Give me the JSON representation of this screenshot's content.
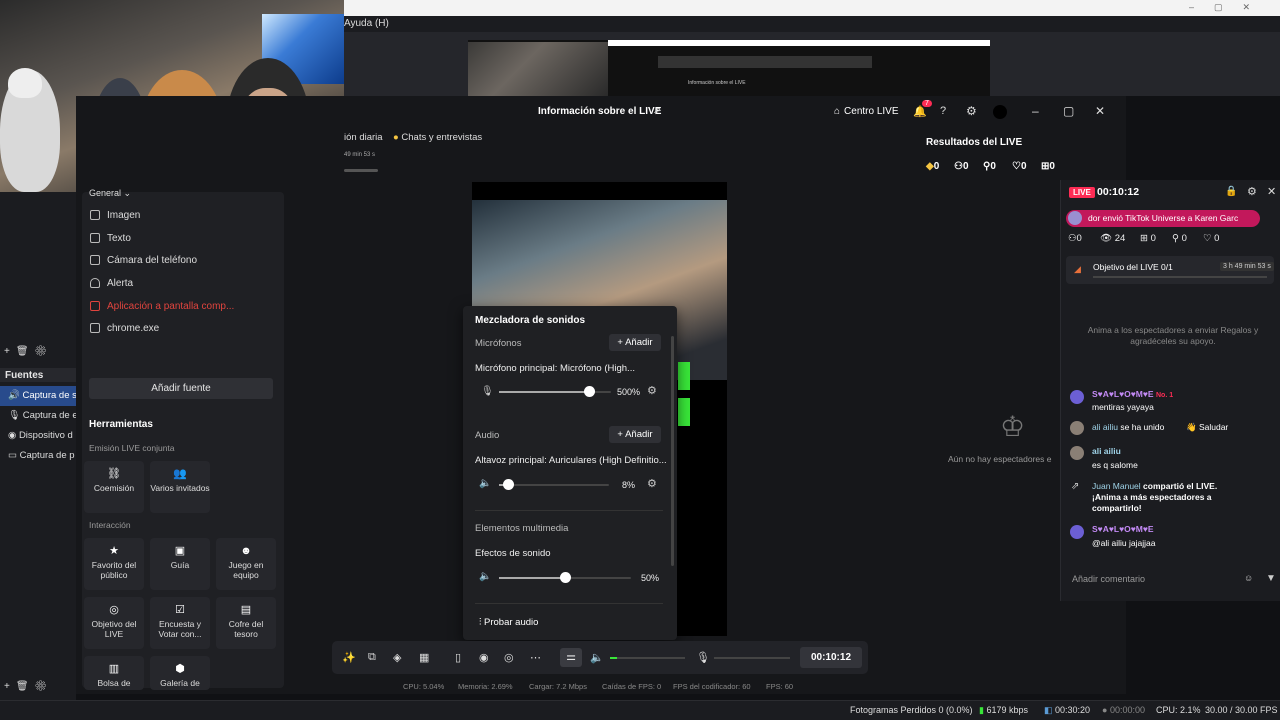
{
  "obs": {
    "menu_help": "Ayuda (H)",
    "sources_header": "Fuentes",
    "sources": [
      "Captura de s",
      "Captura de e",
      "Dispositivo d",
      "Captura de p"
    ],
    "status": {
      "dropped": "Fotogramas Perdidos 0 (0.0%)",
      "bitrate": "6179 kbps",
      "stream_time": "00:30:20",
      "rec_time": "00:00:00",
      "cpu": "CPU: 2.1%",
      "fps": "30.00 / 30.00 FPS"
    }
  },
  "nested_preview": {
    "text": "Información sobre el LIVE"
  },
  "tiktok": {
    "title": "Información sobre el LIVE",
    "centro": "Centro LIVE",
    "notif_count": "7",
    "tabs": [
      "ión diaria",
      "Chats y entrevistas"
    ],
    "tab_small": "49 min 53 s",
    "panel_menu_header": "General",
    "sources_menu": [
      "Imagen",
      "Texto",
      "Cámara del teléfono",
      "Alerta",
      "Aplicación a pantalla comp...",
      "chrome.exe"
    ],
    "add_source": "Añadir fuente",
    "tools_title": "Herramientas",
    "emision_label": "Emisión LIVE conjunta",
    "interaccion_label": "Interacción",
    "tools_row1": [
      {
        "icon": "⛓",
        "label": "Coemisión"
      },
      {
        "icon": "👥",
        "label": "Varios invitados"
      }
    ],
    "tools_row2": [
      {
        "icon": "★",
        "label": "Favorito del público"
      },
      {
        "icon": "▣",
        "label": "Guía"
      },
      {
        "icon": "☻",
        "label": "Juego en equipo"
      }
    ],
    "tools_row3": [
      {
        "icon": "◎",
        "label": "Objetivo del LIVE"
      },
      {
        "icon": "☑",
        "label": "Encuesta y Votar con..."
      },
      {
        "icon": "▤",
        "label": "Cofre del tesoro"
      }
    ],
    "tools_row4": [
      {
        "icon": "▥",
        "label": "Bolsa de"
      },
      {
        "icon": "⬢",
        "label": "Galería de"
      }
    ],
    "mixer": {
      "title": "Mezcladora de sonidos",
      "mic_section": "Micrófonos",
      "add": "Añadir",
      "mic_label": "Micrófono principal: Micrófono (High...",
      "mic_value": "500%",
      "mic_level": 0.8,
      "audio_section": "Audio",
      "audio_label": "Altavoz principal: Auriculares (High Definitio...",
      "audio_value": "8%",
      "audio_level": 0.08,
      "media_section": "Elementos multimedia",
      "fx_label": "Efectos de sonido",
      "fx_value": "50%",
      "fx_level": 0.5,
      "test_audio": "Probar audio"
    },
    "bottom_timer": "00:10:12",
    "stats": [
      "CPU: 5.04%",
      "Memoria: 2.69%",
      "Cargar: 7.2 Mbps",
      "Caídas de FPS: 0",
      "FPS del codificador: 60",
      "FPS: 60"
    ],
    "results": {
      "title": "Resultados del LIVE",
      "counts": [
        "0",
        "0",
        "0",
        "0",
        "0"
      ],
      "no_viewers": "Aún no hay espectadores e"
    }
  },
  "live_panel": {
    "badge": "LIVE",
    "timer": "00:10:12",
    "gift_text": "dor  envió TikTok Universe a Karen Garc",
    "counts": [
      "0",
      "24",
      "0",
      "0",
      "0"
    ],
    "goal_label": "Objetivo del LIVE 0/1",
    "goal_time": "3 h 49 min 53 s",
    "invite_text": "Anima a los espectadores a enviar Regalos y agradéceles su apoyo.",
    "chat": [
      {
        "name": "S♥A♥L♥O♥M♥E",
        "badge": "No. 1",
        "msg": "mentiras yayaya"
      },
      {
        "name": "ali ailiu",
        "msg": "se ha unido",
        "action": "Saludar"
      },
      {
        "name": "ali ailiu",
        "msg": "es q salome"
      },
      {
        "name": "Juan Manuel",
        "msg": "compartió el LIVE. ¡Anima a más espectadores a compartirlo!"
      },
      {
        "name": "S♥A♥L♥O♥M♥E",
        "msg": "@ali ailiu jajajjaa"
      }
    ],
    "comment_placeholder": "Añadir comentario"
  }
}
